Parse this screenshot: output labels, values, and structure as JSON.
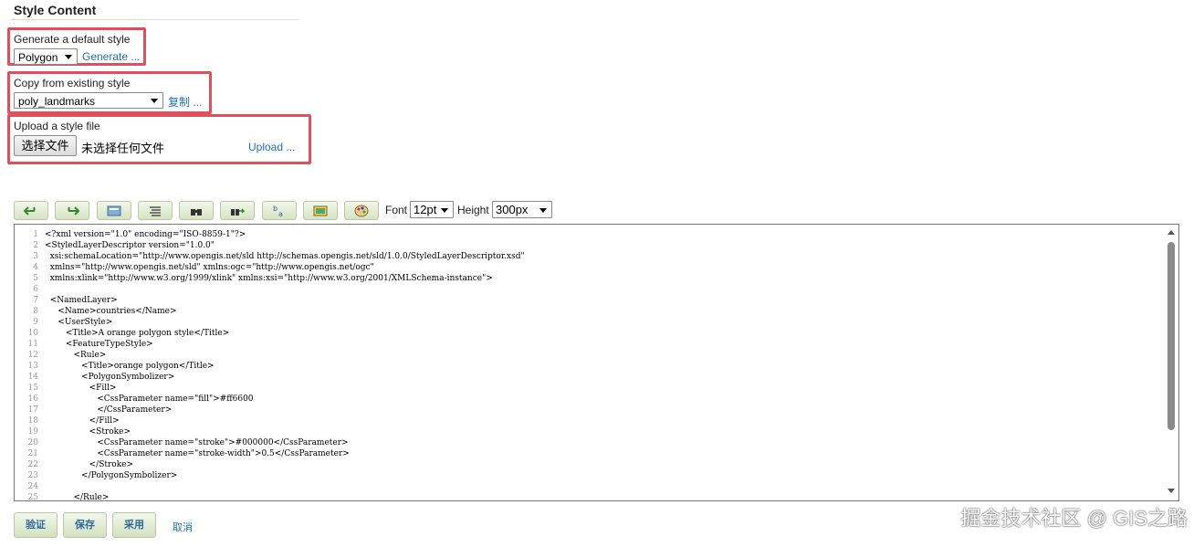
{
  "section_title": "Style Content",
  "generate": {
    "label": "Generate a default style",
    "selected": "Polygon",
    "action": "Generate ..."
  },
  "copy": {
    "label": "Copy from existing style",
    "selected": "poly_landmarks",
    "action": "复制 ..."
  },
  "upload": {
    "label": "Upload a style file",
    "choose_button": "选择文件",
    "no_file": "未选择任何文件",
    "action": "Upload ..."
  },
  "toolbar": {
    "font_label": "Font",
    "font_value": "12pt",
    "height_label": "Height",
    "height_value": "300px"
  },
  "editor": {
    "lines": [
      {
        "n": "1",
        "t": "<?xml version=\"1.0\" encoding=\"ISO-8859-1\"?>"
      },
      {
        "n": "2",
        "t": "<StyledLayerDescriptor version=\"1.0.0\""
      },
      {
        "n": "3",
        "t": "  xsi:schemaLocation=\"http://www.opengis.net/sld http://schemas.opengis.net/sld/1.0.0/StyledLayerDescriptor.xsd\""
      },
      {
        "n": "4",
        "t": "  xmlns=\"http://www.opengis.net/sld\" xmlns:ogc=\"http://www.opengis.net/ogc\""
      },
      {
        "n": "5",
        "t": "  xmlns:xlink=\"http://www.w3.org/1999/xlink\" xmlns:xsi=\"http://www.w3.org/2001/XMLSchema-instance\">"
      },
      {
        "n": "6",
        "t": ""
      },
      {
        "n": "7",
        "t": "  <NamedLayer>"
      },
      {
        "n": "8",
        "t": "     <Name>countries</Name>"
      },
      {
        "n": "9",
        "t": "     <UserStyle>"
      },
      {
        "n": "10",
        "t": "        <Title>A orange polygon style</Title>"
      },
      {
        "n": "11",
        "t": "        <FeatureTypeStyle>"
      },
      {
        "n": "12",
        "t": "           <Rule>"
      },
      {
        "n": "13",
        "t": "              <Title>orange polygon</Title>"
      },
      {
        "n": "14",
        "t": "              <PolygonSymbolizer>"
      },
      {
        "n": "15",
        "t": "                 <Fill>"
      },
      {
        "n": "16",
        "t": "                    <CssParameter name=\"fill\">#ff6600"
      },
      {
        "n": "17",
        "t": "                    </CssParameter>"
      },
      {
        "n": "18",
        "t": "                 </Fill>"
      },
      {
        "n": "19",
        "t": "                 <Stroke>"
      },
      {
        "n": "20",
        "t": "                    <CssParameter name=\"stroke\">#000000</CssParameter>"
      },
      {
        "n": "21",
        "t": "                    <CssParameter name=\"stroke-width\">0.5</CssParameter>"
      },
      {
        "n": "22",
        "t": "                 </Stroke>"
      },
      {
        "n": "23",
        "t": "              </PolygonSymbolizer>"
      },
      {
        "n": "24",
        "t": ""
      },
      {
        "n": "25",
        "t": "           </Rule>"
      }
    ]
  },
  "actions": {
    "validate": "验证",
    "save": "保存",
    "apply": "采用",
    "cancel": "取消"
  },
  "watermark": "掘金技术社区 @ GIS之路",
  "colors": {
    "highlight": "#e0505a",
    "link": "#1d72b8",
    "button_green": "#d6e4c2"
  }
}
